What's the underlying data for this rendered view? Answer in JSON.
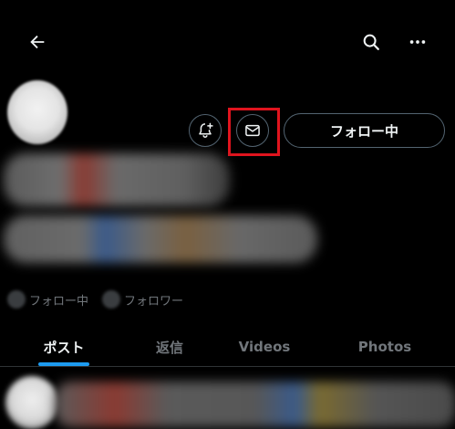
{
  "header": {
    "back_icon": "arrow-left-icon",
    "search_icon": "search-icon",
    "more_icon": "more-horizontal-icon"
  },
  "profile": {
    "notify_icon": "bell-plus-icon",
    "message_icon": "mail-icon",
    "follow_button_label": "フォロー中",
    "following_label": "フォロー中",
    "followers_label": "フォロワー"
  },
  "tabs": [
    {
      "label": "ポスト",
      "active": true
    },
    {
      "label": "返信",
      "active": false
    },
    {
      "label": "Videos",
      "active": false
    },
    {
      "label": "Photos",
      "active": false
    }
  ],
  "colors": {
    "background": "#000000",
    "accent": "#1d9bf0",
    "highlight": "#e0141e",
    "border": "#536471",
    "muted_text": "#71767b"
  }
}
